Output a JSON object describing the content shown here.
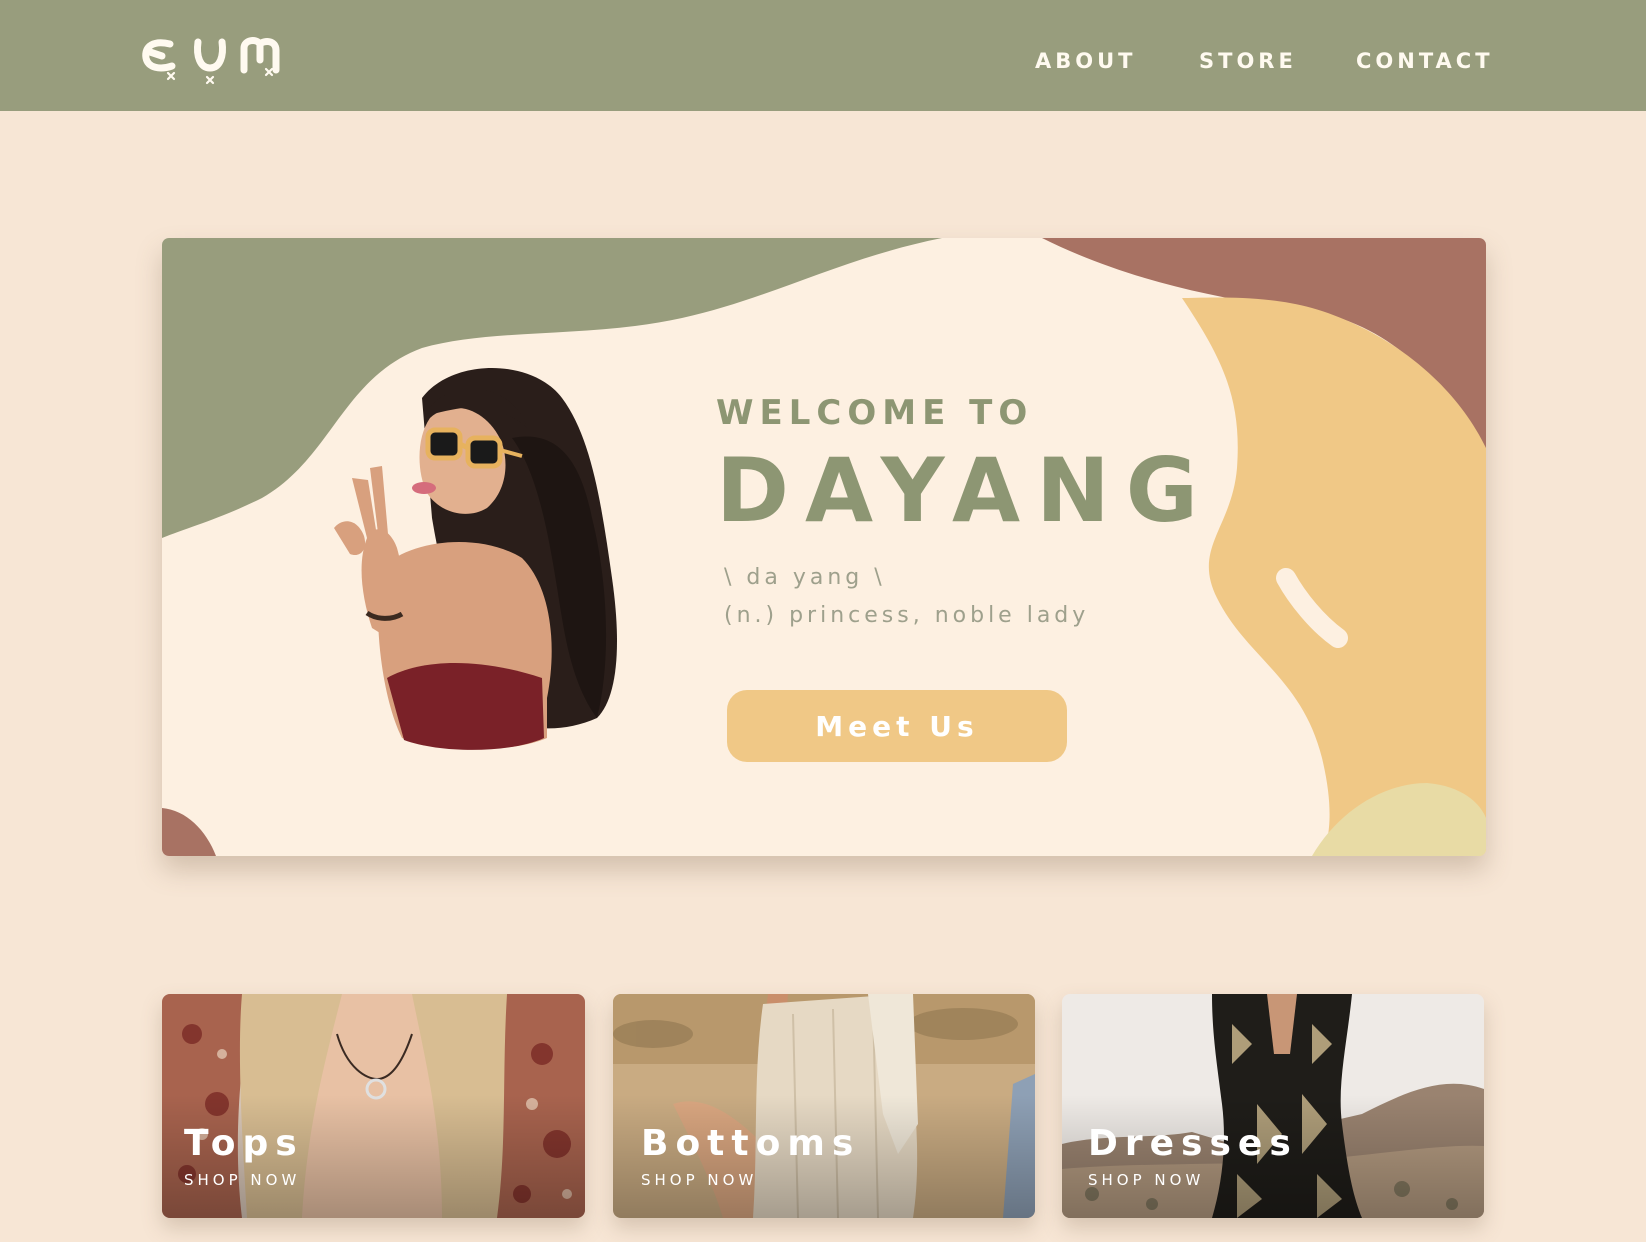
{
  "header": {
    "logo_name": "dayang-script-logo",
    "nav": [
      {
        "label": "ABOUT"
      },
      {
        "label": "STORE"
      },
      {
        "label": "CONTACT"
      }
    ]
  },
  "hero": {
    "welcome": "WELCOME TO",
    "brand": "DAYANG",
    "pronunciation": "\\ da yang \\",
    "definition": "(n.) princess, noble lady",
    "cta_label": "Meet Us",
    "portrait": "woman-with-sunglasses-peace-sign-photo"
  },
  "categories": [
    {
      "title": "Tops",
      "subtitle": "SHOP NOW",
      "photo": "patterned-top-necklace-photo"
    },
    {
      "title": "Bottoms",
      "subtitle": "SHOP NOW",
      "photo": "linen-skirt-desert-photo"
    },
    {
      "title": "Dresses",
      "subtitle": "SHOP NOW",
      "photo": "patterned-dress-desert-photo"
    }
  ],
  "colors": {
    "page_bg": "#f7e6d5",
    "nav_bg": "#989d7d",
    "sage": "#8d9673",
    "cream": "#fdf0e1",
    "mustard": "#f0c886",
    "terracotta": "#a87263"
  }
}
